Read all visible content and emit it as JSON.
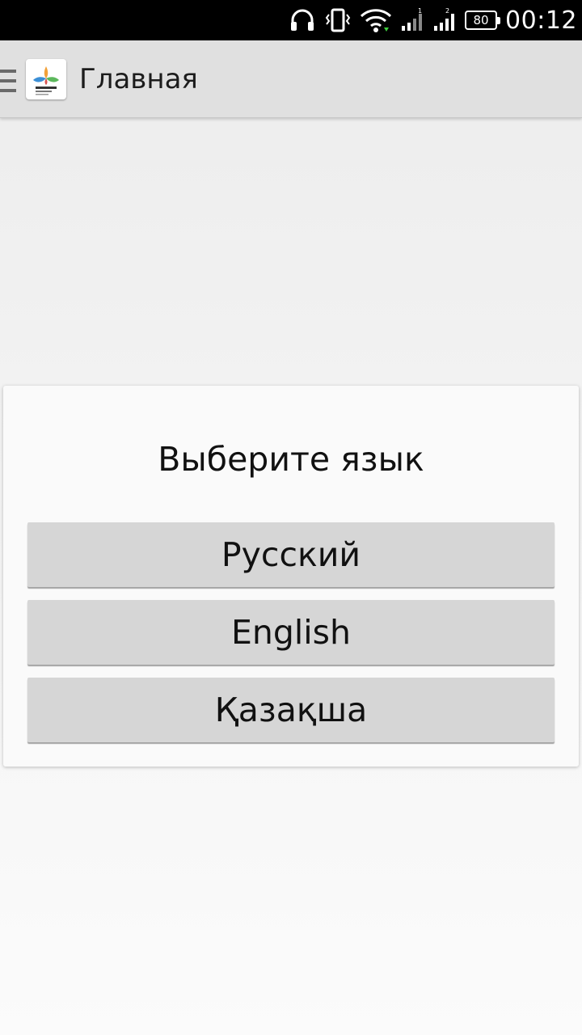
{
  "status_bar": {
    "battery_level": "80",
    "time": "00:12",
    "icons": [
      "headphones-icon",
      "vibrate-icon",
      "wifi-icon",
      "signal-1-icon",
      "signal-2-icon",
      "battery-icon"
    ]
  },
  "app_bar": {
    "title": "Главная",
    "logo": "expo-2017-logo"
  },
  "dialog": {
    "title": "Выберите язык",
    "options": [
      {
        "label": "Русский"
      },
      {
        "label": "English"
      },
      {
        "label": "Қазақша"
      }
    ]
  },
  "colors": {
    "status_bar_bg": "#000000",
    "app_bar_bg": "#e0e0e0",
    "dialog_bg": "#fafafa",
    "button_bg": "#d6d6d6"
  }
}
